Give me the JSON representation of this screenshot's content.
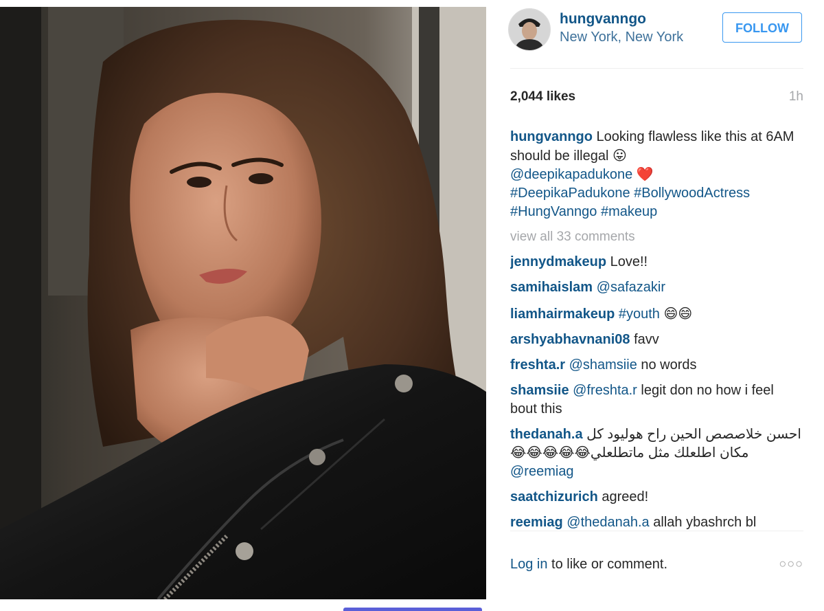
{
  "post": {
    "author": "hungvanngo",
    "location": "New York, New York",
    "follow_label": "FOLLOW",
    "likes": "2,044 likes",
    "time_ago": "1h",
    "caption": {
      "user": "hungvanngo",
      "text_1": " Looking flawless like this at 6AM should be illegal ",
      "emoji_1": "😛",
      "mention": "@deepikapadukone",
      "emoji_2": "❤️",
      "hashtags": "#DeepikaPadukone #BollywoodActress #HungVanngo #makeup"
    },
    "view_all": "view all 33 comments",
    "comments": [
      {
        "user": "jennydmakeup",
        "link": "",
        "text": "Love!!"
      },
      {
        "user": "samihaislam",
        "link": "@safazakir",
        "text": ""
      },
      {
        "user": "liamhairmakeup",
        "link": "#youth",
        "text": "😄😄"
      },
      {
        "user": "arshyabhavnani08",
        "link": "",
        "text": "favv"
      },
      {
        "user": "freshta.r",
        "link": "@shamsiie",
        "text": "no words"
      },
      {
        "user": "shamsiie",
        "link": "@freshta.r",
        "text": "legit don no how i feel bout this"
      },
      {
        "user": "thedanah.a",
        "link": "",
        "text": "احسن خلاصصص الحين راح هوليود كل مكان اطلعلك مثل ماتطلعلي😂😂😂😂😂",
        "link_after": "@reemiag"
      },
      {
        "user": "saatchizurich",
        "link": "",
        "text": "agreed!"
      },
      {
        "user": "reemiag",
        "link": "@thedanah.a",
        "text": "allah ybashrch bl"
      }
    ],
    "login_link": "Log in",
    "login_rest": " to like or comment.",
    "more_label": "○○○"
  },
  "colors": {
    "username": "#125688",
    "location": "#3f729b",
    "follow": "#3897f0",
    "muted": "#a5a7aa"
  },
  "icons": {
    "avatar": "profile-avatar",
    "more": "more-options-icon"
  }
}
